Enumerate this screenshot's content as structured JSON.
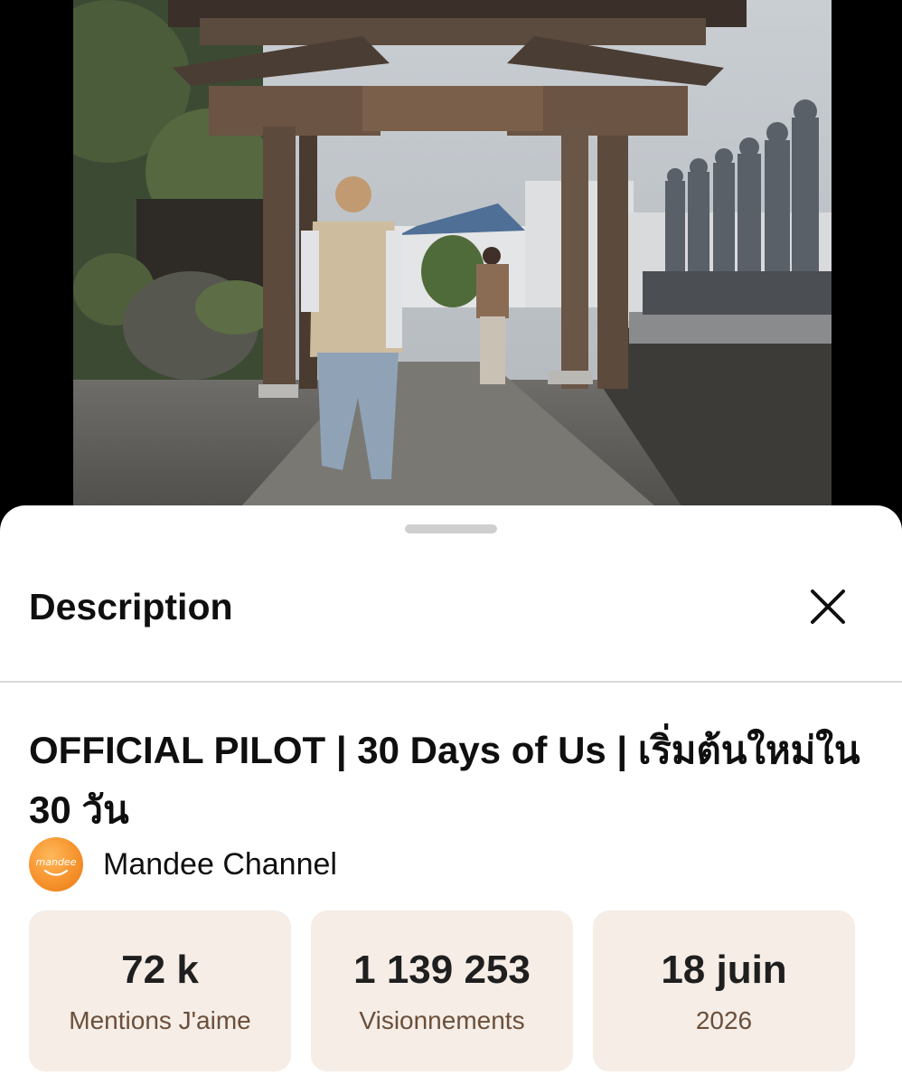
{
  "sheet": {
    "title": "Description",
    "close_icon": "close-icon"
  },
  "video": {
    "title": "OFFICIAL PILOT | 30 Days of Us | เริ่มต้นใหม่ใน 30 วัน",
    "channel": {
      "name": "Mandee Channel",
      "avatar_text": "mandee"
    },
    "stats": [
      {
        "value": "72 k",
        "label": "Mentions J'aime"
      },
      {
        "value": "1 139 253",
        "label": "Visionnements"
      },
      {
        "value": "18 juin",
        "label": "2026"
      }
    ]
  },
  "colors": {
    "sheet_bg": "#ffffff",
    "stat_bg": "#f5ede6",
    "stat_label": "#6b4f3a",
    "avatar": "#f5902a"
  }
}
